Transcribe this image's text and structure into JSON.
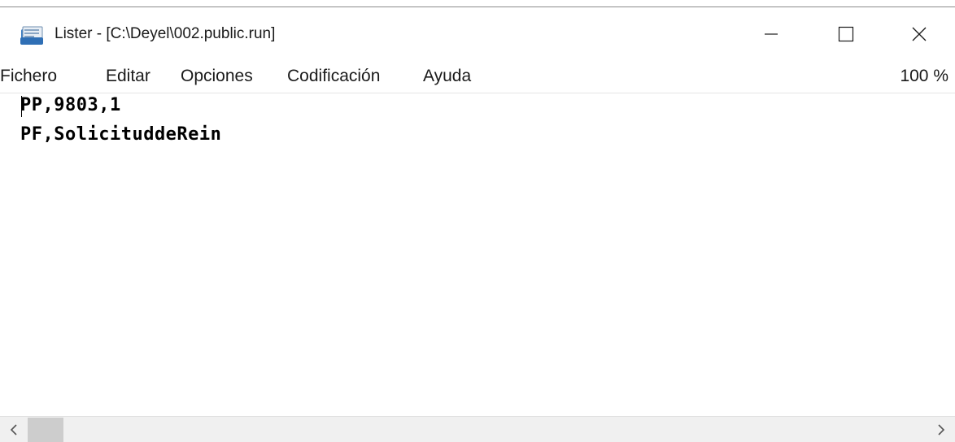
{
  "window": {
    "title": "Lister - [C:\\Deyel\\002.public.run]",
    "app_icon": "lister-app-icon",
    "controls": {
      "minimize": "minimize-icon",
      "maximize": "maximize-icon",
      "close": "close-icon"
    }
  },
  "menubar": {
    "items": [
      {
        "label": "Fichero"
      },
      {
        "label": "Editar"
      },
      {
        "label": "Opciones"
      },
      {
        "label": "Codificación"
      },
      {
        "label": "Ayuda"
      }
    ],
    "zoom": "100 %"
  },
  "content": {
    "lines": [
      "PP,9803,1",
      "PF,SolicituddeRein"
    ]
  },
  "scrollbar": {
    "left_icon": "chevron-left-icon",
    "right_icon": "chevron-right-icon"
  }
}
